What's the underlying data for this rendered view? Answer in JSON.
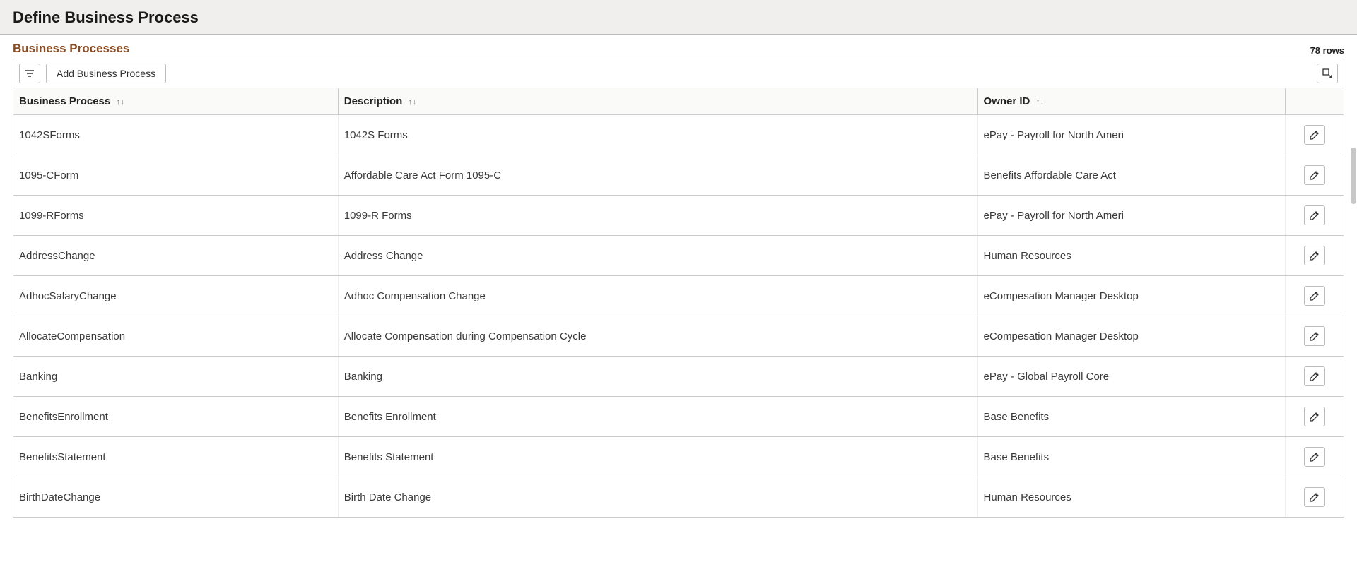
{
  "page": {
    "title": "Define Business Process"
  },
  "section": {
    "title": "Business Processes",
    "row_count_label": "78 rows"
  },
  "toolbar": {
    "add_label": "Add Business Process"
  },
  "table": {
    "headers": {
      "process": "Business Process",
      "description": "Description",
      "owner": "Owner ID"
    },
    "sort_glyph": "↑↓",
    "rows": [
      {
        "process": "1042SForms",
        "description": "1042S Forms",
        "owner": "ePay - Payroll for North Ameri"
      },
      {
        "process": "1095-CForm",
        "description": "Affordable Care Act Form 1095-C",
        "owner": "Benefits Affordable Care Act"
      },
      {
        "process": "1099-RForms",
        "description": "1099-R Forms",
        "owner": "ePay - Payroll for North Ameri"
      },
      {
        "process": "AddressChange",
        "description": "Address Change",
        "owner": "Human Resources"
      },
      {
        "process": "AdhocSalaryChange",
        "description": "Adhoc Compensation Change",
        "owner": "eCompesation Manager Desktop"
      },
      {
        "process": "AllocateCompensation",
        "description": "Allocate Compensation during Compensation Cycle",
        "owner": "eCompesation Manager Desktop"
      },
      {
        "process": "Banking",
        "description": "Banking",
        "owner": "ePay - Global Payroll Core"
      },
      {
        "process": "BenefitsEnrollment",
        "description": "Benefits Enrollment",
        "owner": "Base Benefits"
      },
      {
        "process": "BenefitsStatement",
        "description": "Benefits Statement",
        "owner": "Base Benefits"
      },
      {
        "process": "BirthDateChange",
        "description": "Birth Date Change",
        "owner": "Human Resources"
      }
    ]
  }
}
